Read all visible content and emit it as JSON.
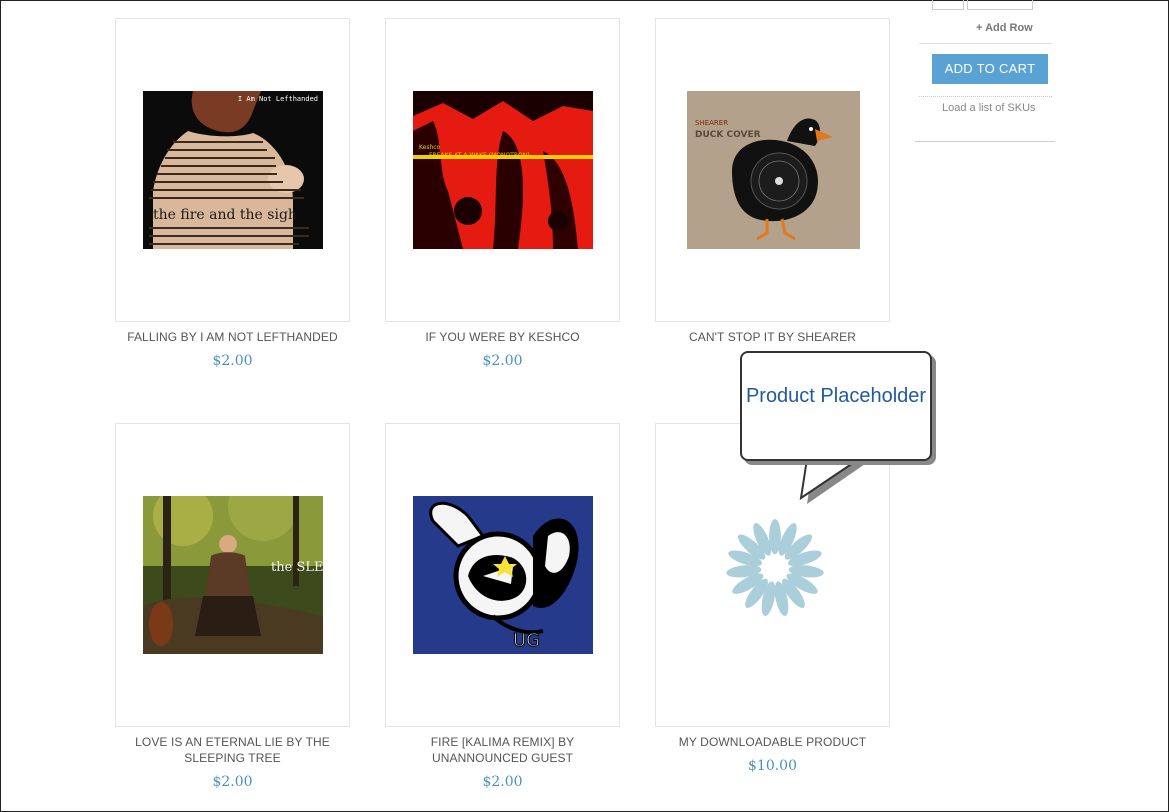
{
  "sidebar": {
    "add_row": "+ Add Row",
    "add_to_cart": "ADD TO CART",
    "load_skus": "Load a list of SKUs"
  },
  "products": [
    {
      "name": "FALLING BY I AM NOT LEFTHANDED",
      "price": "$2.00"
    },
    {
      "name": "IF YOU WERE BY KESHCO",
      "price": "$2.00"
    },
    {
      "name": "CAN'T STOP IT BY SHEARER",
      "price": ""
    },
    {
      "name": "LOVE IS AN ETERNAL LIE BY THE SLEEPING TREE",
      "price": "$2.00"
    },
    {
      "name": "FIRE [KALIMA REMIX] BY UNANNOUNCED GUEST",
      "price": "$2.00"
    },
    {
      "name": "MY DOWNLOADABLE PRODUCT",
      "price": "$10.00"
    }
  ],
  "covers": {
    "falling": {
      "band": "I Am Not Lefthanded",
      "text": "the fire and the sigh"
    },
    "keshco": {
      "band": "Keshco",
      "text": "FREAKS AT A WAKE (MONOTRON)"
    },
    "shearer": {
      "band": "SHEARER",
      "text": "DUCK COVER"
    },
    "sleeping_tree": {
      "text": "the SLEEPING TREE"
    },
    "fire": {
      "text": "UG"
    }
  },
  "callout": {
    "text": "Product Placeholder"
  },
  "colors": {
    "accent": "#5aa2d3",
    "price": "#4b8fbf",
    "placeholder": "#aacfdb"
  }
}
